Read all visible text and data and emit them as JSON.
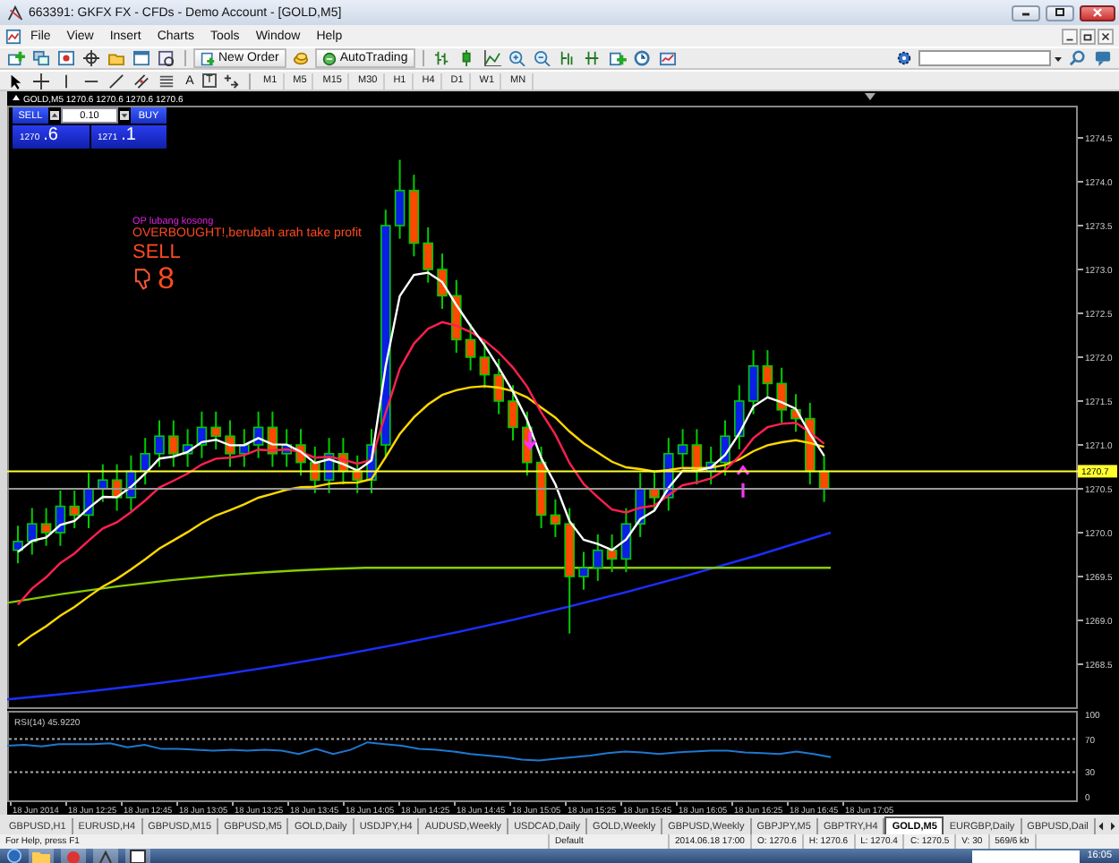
{
  "window": {
    "title": "663391: GKFX FX - CFDs - Demo Account - [GOLD,M5]"
  },
  "menu": [
    "File",
    "View",
    "Insert",
    "Charts",
    "Tools",
    "Window",
    "Help"
  ],
  "toolbar": {
    "new_order": "New Order",
    "autotrading": "AutoTrading"
  },
  "drawing_tools": [
    "A",
    "T"
  ],
  "periods": [
    "M1",
    "M5",
    "M15",
    "M30",
    "H1",
    "H4",
    "D1",
    "W1",
    "MN"
  ],
  "chart": {
    "header": "GOLD,M5  1270.6 1270.6 1270.6 1270.6",
    "trade_panel": {
      "sell": "SELL",
      "lot": "0.10",
      "buy": "BUY",
      "sell_price": {
        "figure": "1270",
        "pips": ".6"
      },
      "buy_price": {
        "figure": "1271",
        "pips": ".1"
      }
    },
    "signals": {
      "note": "OP lubang kosong",
      "message": "OVERBOUGHT!,berubah arah take profit",
      "action": "SELL",
      "count": "8"
    },
    "price_labels": [
      "1274.5",
      "1274.0",
      "1273.5",
      "1273.0",
      "1272.5",
      "1272.0",
      "1271.5",
      "1271.0",
      "1270.5",
      "1270.0",
      "1269.5",
      "1269.0",
      "1268.5"
    ],
    "current_price": "1270.7",
    "rsi": {
      "label": "RSI(14) 45.9220",
      "levels": [
        "100",
        "70",
        "30",
        "0"
      ]
    },
    "time_labels": [
      "18 Jun 2014",
      "18 Jun 12:25",
      "18 Jun 12:45",
      "18 Jun 13:05",
      "18 Jun 13:25",
      "18 Jun 13:45",
      "18 Jun 14:05",
      "18 Jun 14:25",
      "18 Jun 14:45",
      "18 Jun 15:05",
      "18 Jun 15:25",
      "18 Jun 15:45",
      "18 Jun 16:05",
      "18 Jun 16:25",
      "18 Jun 16:45",
      "18 Jun 17:05"
    ]
  },
  "tabs": [
    {
      "label": "GBPUSD,H1",
      "selected": false
    },
    {
      "label": "EURUSD,H4",
      "selected": false
    },
    {
      "label": "GBPUSD,M15",
      "selected": false
    },
    {
      "label": "GBPUSD,M5",
      "selected": false
    },
    {
      "label": "GOLD,Daily",
      "selected": false
    },
    {
      "label": "USDJPY,H4",
      "selected": false
    },
    {
      "label": "AUDUSD,Weekly",
      "selected": false
    },
    {
      "label": "USDCAD,Daily",
      "selected": false
    },
    {
      "label": "GOLD,Weekly",
      "selected": false
    },
    {
      "label": "GBPUSD,Weekly",
      "selected": false
    },
    {
      "label": "GBPJPY,M5",
      "selected": false
    },
    {
      "label": "GBPTRY,H4",
      "selected": false
    },
    {
      "label": "GOLD,M5",
      "selected": true
    },
    {
      "label": "EURGBP,Daily",
      "selected": false
    },
    {
      "label": "GBPUSD,Dail",
      "selected": false
    }
  ],
  "status_bar": [
    "For Help, press F1",
    "Default",
    "2014.06.18 17:00",
    "O: 1270.6",
    "H: 1270.6",
    "L: 1270.4",
    "C: 1270.5",
    "V: 30",
    "569/6 kb"
  ],
  "taskbar": {
    "clock": "16:05"
  }
}
